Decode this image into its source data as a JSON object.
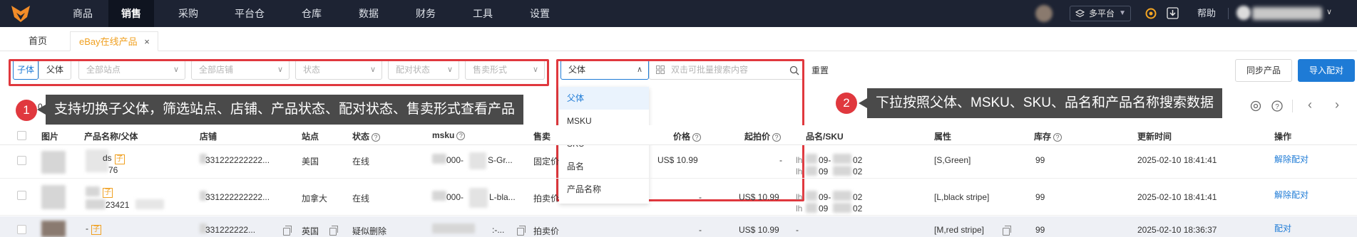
{
  "nav": {
    "items": [
      "商品",
      "销售",
      "采购",
      "平台仓",
      "仓库",
      "数据",
      "财务",
      "工具",
      "设置"
    ],
    "platform_label": "多平台",
    "help_label": "帮助"
  },
  "tabs": {
    "home": "首页",
    "active": "eBay在线产品",
    "close": "×"
  },
  "filters": {
    "sub": "子体",
    "parent": "父体",
    "site": "全部站点",
    "shop": "全部店铺",
    "status": "状态",
    "match_status": "配对状态",
    "sell_type": "售卖形式",
    "search_type": "父体",
    "search_placeholder": "双击可批量搜索内容",
    "reset": "重置",
    "sync": "同步产品",
    "import": "导入配对"
  },
  "dropdown": {
    "options": [
      "父体",
      "MSKU",
      "SKU",
      "品名",
      "产品名称"
    ]
  },
  "callouts": [
    {
      "num": "1",
      "text": "支持切换子父体，筛选站点、店铺、产品状态、配对状态、售卖形式查看产品"
    },
    {
      "num": "2",
      "text": "下拉按照父体、MSKU、SKU、品名和产品名称搜索数据"
    }
  ],
  "toolbar_partial": "0",
  "table": {
    "headers": {
      "image": "图片",
      "name": "产品名称/父体",
      "shop": "店铺",
      "site": "站点",
      "status": "状态",
      "msku": "msku",
      "sell": "售卖",
      "price": "价格",
      "start_price": "起拍价",
      "sku": "品名/SKU",
      "attr": "属性",
      "stock": "库存",
      "updated": "更新时间",
      "action": "操作"
    },
    "rows": [
      {
        "name_a": "ds",
        "name_b": "76",
        "shop": "331222222222...",
        "site": "美国",
        "status": "在线",
        "msku_a": "000-",
        "msku_b": "S-Gr...",
        "sell": "固定价",
        "price": "US$ 10.99",
        "start_price": "-",
        "sku_a": "09-",
        "sku_b": "02",
        "sku_c": "09",
        "sku_d": "02",
        "attr": "[S,Green]",
        "stock": "99",
        "updated": "2025-02-10 18:41:41",
        "action": "解除配对"
      },
      {
        "name_a": "",
        "name_b": "23421",
        "shop": "331222222222...",
        "site": "加拿大",
        "status": "在线",
        "msku_a": "000-",
        "msku_b": "L-bla...",
        "sell": "拍卖价",
        "price": "-",
        "start_price": "US$ 10.99",
        "sku_a": "09-",
        "sku_b": "02",
        "sku_c": "09",
        "sku_d": "02",
        "attr": "[L,black stripe]",
        "stock": "99",
        "updated": "2025-02-10 18:41:41",
        "action": "解除配对"
      },
      {
        "name_a": "-",
        "name_b": "",
        "shop": "331222222...",
        "site": "英国",
        "status": "疑似删除",
        "msku_a": "",
        "msku_b": ":-...",
        "sell": "拍卖价",
        "price": "-",
        "start_price": "US$ 10.99",
        "sku_a": "-",
        "sku_b": "",
        "sku_c": "",
        "sku_d": "",
        "attr": "[M,red stripe]",
        "stock": "99",
        "updated": "2025-02-10 18:36:37",
        "action": "配对"
      }
    ]
  },
  "colors": {
    "nav_bg": "#1d2333",
    "accent": "#1e7bd6",
    "highlight_red": "#e0383e",
    "tag_orange": "#f0a020"
  }
}
